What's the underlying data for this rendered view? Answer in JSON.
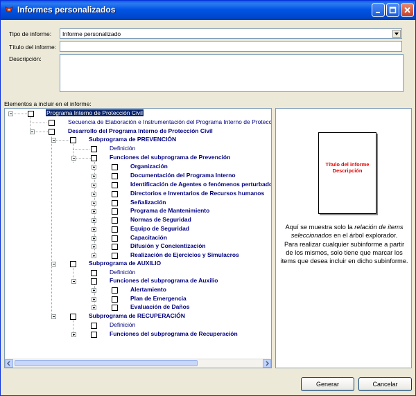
{
  "window": {
    "title": "Informes personalizados"
  },
  "form": {
    "tipo_label": "Tipo de informe:",
    "tipo_value": "Informe personalizado",
    "titulo_label": "Título del informe:",
    "titulo_value": "",
    "descripcion_label": "Descripción:",
    "descripcion_value": "",
    "elementos_label": "Elementos a incluir en el informe:"
  },
  "tree": {
    "root": "Programa Interno de Protección Civil",
    "secuencia": "Secuencia de Elaboración e Instrumentación del Programa Interno de Protección Civil",
    "desarrollo": "Desarrollo del Programa Interno de Protección Civil",
    "prevencion": {
      "label": "Subprograma de PREVENCIÓN",
      "definicion": "Definición",
      "funciones": "Funciones del subprograma de Prevención",
      "items": [
        "Organización",
        "Documentación del Programa Interno",
        "Identificación de Agentes o fenómenos perturbadores",
        "Directorios e Inventarios de Recursos humanos",
        "Señalización",
        "Programa de Mantenimiento",
        "Normas de Seguridad",
        "Equipo de Seguridad",
        "Capacitación",
        "Difusión y Concientización",
        "Realización de Ejercicios y Simulacros"
      ]
    },
    "auxilio": {
      "label": "Subprograma de AUXILIO",
      "definicion": "Definición",
      "funciones": "Funciones del subprograma de Auxilio",
      "items": [
        "Alertamiento",
        "Plan de Emergencia",
        "Evaluación de Daños"
      ]
    },
    "recuperacion": {
      "label": "Subprograma de RECUPERACIÓN",
      "definicion": "Definición",
      "funciones": "Funciones del subprograma de Recuperación"
    }
  },
  "preview": {
    "page_title": "Título del informe",
    "page_desc": "Descripción",
    "text_a": "Aquí se muestra solo la ",
    "text_em": "relación de items seleccionados",
    "text_b": " en el árbol explorador.",
    "text_c": "Para realizar cualquier subinforme a partir de los mismos, solo tiene que marcar los items que desea incluir en dicho subinforme."
  },
  "buttons": {
    "generar": "Generar",
    "cancelar": "Cancelar"
  },
  "colors": {
    "titlebar": "#0055E5",
    "tree_text": "#000080",
    "selection": "#0A246A",
    "preview_title": "#E00000"
  }
}
